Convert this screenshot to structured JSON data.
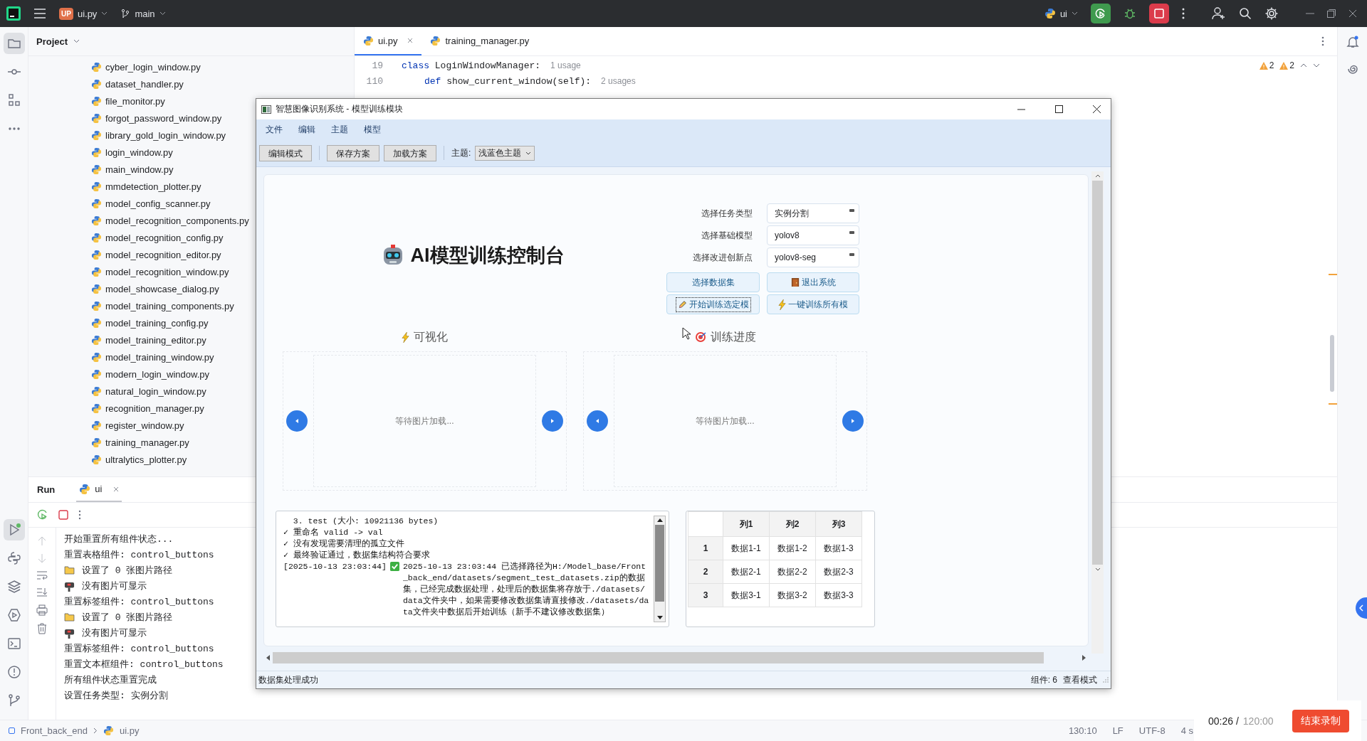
{
  "topbar": {
    "project_badge": "UP",
    "project": "ui.py",
    "branch": "main",
    "run_config": "ui"
  },
  "left_toolbar": {
    "top": [
      {
        "kind": "folder",
        "selected": true
      },
      {
        "kind": "commit",
        "selected": false
      },
      {
        "kind": "structure",
        "selected": false
      },
      {
        "kind": "more",
        "selected": false
      }
    ],
    "bottom": [
      {
        "kind": "run",
        "selected": true
      },
      {
        "kind": "python",
        "selected": false
      },
      {
        "kind": "layers",
        "selected": false
      },
      {
        "kind": "services",
        "selected": false
      },
      {
        "kind": "terminal",
        "selected": false
      },
      {
        "kind": "problems",
        "selected": false
      },
      {
        "kind": "git",
        "selected": false
      }
    ]
  },
  "project_panel": {
    "title": "Project",
    "files": [
      "cyber_login_window.py",
      "dataset_handler.py",
      "file_monitor.py",
      "forgot_password_window.py",
      "library_gold_login_window.py",
      "login_window.py",
      "main_window.py",
      "mmdetection_plotter.py",
      "model_config_scanner.py",
      "model_recognition_components.py",
      "model_recognition_config.py",
      "model_recognition_editor.py",
      "model_recognition_window.py",
      "model_showcase_dialog.py",
      "model_training_components.py",
      "model_training_config.py",
      "model_training_editor.py",
      "model_training_window.py",
      "modern_login_window.py",
      "natural_login_window.py",
      "recognition_manager.py",
      "register_window.py",
      "training_manager.py",
      "ultralytics_plotter.py"
    ]
  },
  "editor": {
    "tabs": [
      {
        "label": "ui.py",
        "selected": true
      },
      {
        "label": "training_manager.py",
        "selected": false
      }
    ],
    "lines": [
      {
        "number": "19",
        "keyword": "class",
        "code": "LoginWindowManager:",
        "hint": "1 usage",
        "children": [
          {
            "number": "110",
            "keyword": "def",
            "code": "show_current_window(self):",
            "hint": "2 usages"
          }
        ]
      }
    ],
    "warnings": [
      "2",
      "2"
    ]
  },
  "run_panel": {
    "title": "Run",
    "tab": "ui",
    "lines": [
      {
        "kind": "text",
        "text": "开始重置所有组件状态..."
      },
      {
        "kind": "text",
        "text": "重置表格组件: control_buttons"
      },
      {
        "kind": "folder",
        "text": "设置了 0 张图片路径"
      },
      {
        "kind": "mailbox",
        "text": "没有图片可显示"
      },
      {
        "kind": "text",
        "text": "重置标签组件: control_buttons"
      },
      {
        "kind": "folder",
        "text": "设置了 0 张图片路径"
      },
      {
        "kind": "mailbox",
        "text": "没有图片可显示"
      },
      {
        "kind": "text",
        "text": "重置标签组件: control_buttons"
      },
      {
        "kind": "text",
        "text": "重置文本框组件: control_buttons"
      },
      {
        "kind": "text",
        "text": "所有组件状态重置完成"
      },
      {
        "kind": "text",
        "text": "设置任务类型: 实例分割"
      }
    ]
  },
  "status_bar": {
    "breadcrumbs": [
      "Front_back_end",
      "ui.py"
    ],
    "items": [
      "130:10",
      "LF",
      "UTF-8",
      "4 s"
    ]
  },
  "recording": {
    "elapsed": "00:26 /",
    "total": "120:00",
    "button": "结束录制"
  },
  "app_window": {
    "title": "智慧图像识别系统 - 模型训练模块",
    "menu": [
      "文件",
      "编辑",
      "主题",
      "模型"
    ],
    "toolbar": {
      "buttons": [
        "编辑模式",
        "保存方案",
        "加载方案"
      ],
      "theme_label": "主题:",
      "theme": "浅蓝色主题"
    },
    "heading": "AI模型训练控制台",
    "form": [
      {
        "label": "选择任务类型",
        "value": "实例分割"
      },
      {
        "label": "选择基础模型",
        "value": "yolov8"
      },
      {
        "label": "选择改进创新点",
        "value": "yolov8-seg"
      }
    ],
    "actions": [
      {
        "kind": "plain",
        "label": "选择数据集",
        "focused": false
      },
      {
        "kind": "door",
        "label": "退出系统",
        "focused": false
      },
      {
        "kind": "pencil",
        "label": "开始训练选定模",
        "focused": true
      },
      {
        "kind": "bolt",
        "label": "一键训练所有模",
        "focused": false
      }
    ],
    "panels": [
      {
        "kind": "bolt",
        "title": "可视化",
        "placeholder": "等待图片加载..."
      },
      {
        "kind": "target",
        "title": "训练进度",
        "placeholder": "等待图片加载..."
      }
    ],
    "log": [
      {
        "kind": "plain",
        "text": "  3. test (大小: 10921136 bytes)"
      },
      {
        "kind": "plain",
        "text": "✓ 重命名 valid -> val"
      },
      {
        "kind": "plain",
        "text": "✓ 没有发现需要清理的孤立文件"
      },
      {
        "kind": "plain",
        "text": "✓ 最终验证通过，数据集结构符合要求"
      },
      {
        "kind": "check",
        "timestamp": "[2025-10-13 23:03:44]",
        "text": "2025-10-13 23:03:44 已选择路径为H:/Model_base/Front_back_end/datasets/segment_test_datasets.zip的数据集，已经完成数据处理，处理后的数据集将存放于./datasets/data文件夹中，如果需要修改数据集请直接修改./datasets/data文件夹中数据后开始训练（新手不建议修改数据集）"
      }
    ],
    "table": {
      "columns": [
        "列1",
        "列2",
        "列3"
      ],
      "rows": [
        {
          "index": "1",
          "cells": [
            "数据1-1",
            "数据1-2",
            "数据1-3"
          ]
        },
        {
          "index": "2",
          "cells": [
            "数据2-1",
            "数据2-2",
            "数据2-3"
          ]
        },
        {
          "index": "3",
          "cells": [
            "数据3-1",
            "数据3-2",
            "数据3-3"
          ]
        }
      ]
    },
    "status": "数据集处理成功",
    "component_count": "组件: 6",
    "mode": "查看模式"
  }
}
